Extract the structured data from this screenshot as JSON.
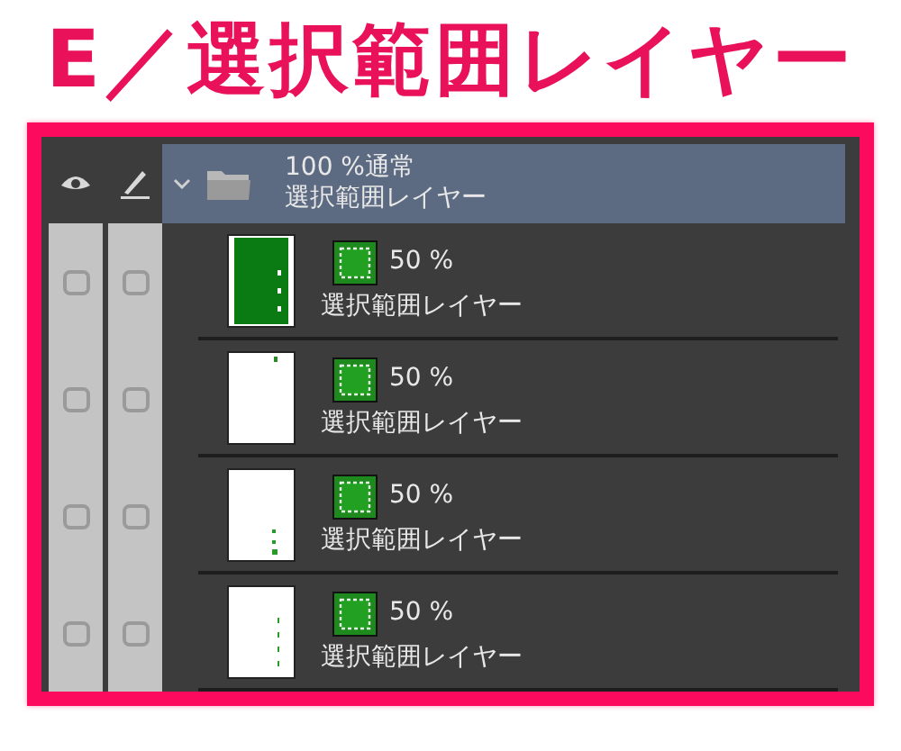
{
  "heading": "E／選択範囲レイヤー",
  "folder": {
    "opacity_mode": "100 %通常",
    "name": "選択範囲レイヤー",
    "expanded": true,
    "selected": true
  },
  "layers": [
    {
      "opacity": "50 %",
      "name": "選択範囲レイヤー",
      "visible": false,
      "editable": false,
      "selected": false,
      "kind": "filled"
    },
    {
      "opacity": "50 %",
      "name": "選択範囲レイヤー",
      "visible": false,
      "editable": false,
      "selected": false,
      "kind": "corner"
    },
    {
      "opacity": "50 %",
      "name": "選択範囲レイヤー",
      "visible": false,
      "editable": false,
      "selected": false,
      "kind": "dots"
    },
    {
      "opacity": "50 %",
      "name": "選択範囲レイヤー",
      "visible": false,
      "editable": false,
      "selected": false,
      "kind": "dashes"
    }
  ]
}
